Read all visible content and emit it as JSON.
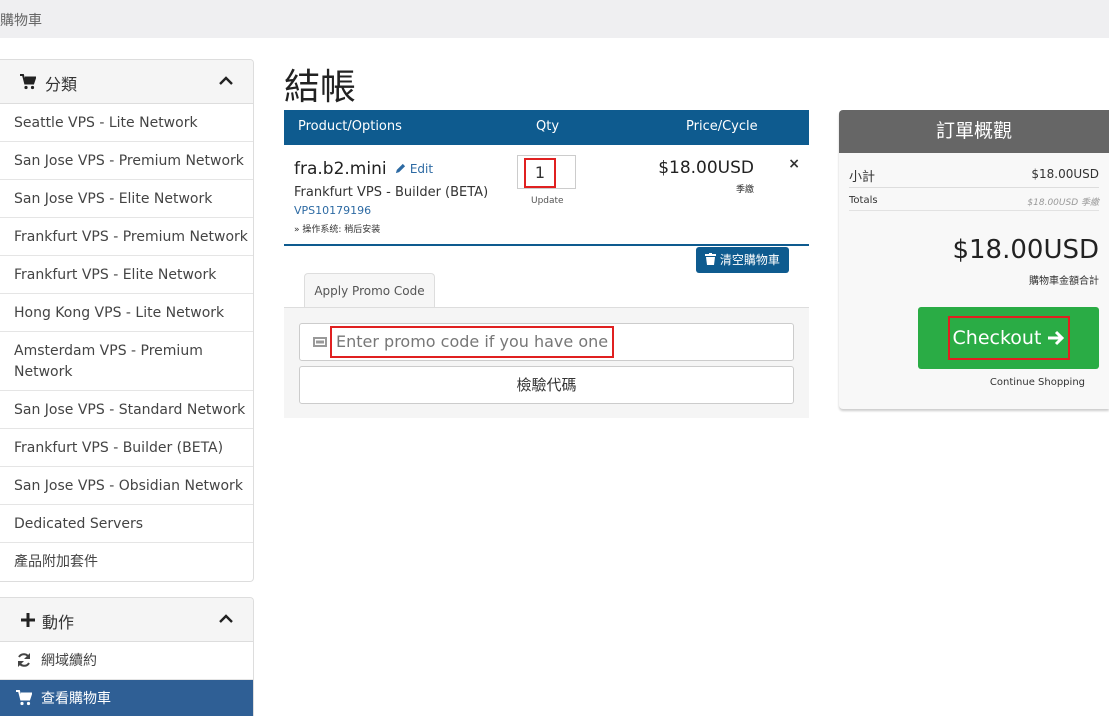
{
  "breadcrumb": "購物車",
  "sidebar": {
    "categories_title": "分類",
    "categories": [
      "Seattle VPS - Lite Network",
      "San Jose VPS - Premium Network",
      "San Jose VPS - Elite Network",
      "Frankfurt VPS - Premium Network",
      "Frankfurt VPS - Elite Network",
      "Hong Kong VPS - Lite Network",
      "Amsterdam VPS - Premium Network",
      "San Jose VPS - Standard Network",
      "Frankfurt VPS - Builder (BETA)",
      "San Jose VPS - Obsidian Network",
      "Dedicated Servers",
      "產品附加套件"
    ],
    "actions_title": "動作",
    "actions": [
      {
        "label": "網域續約",
        "icon": "refresh-icon",
        "active": false
      },
      {
        "label": "查看購物車",
        "icon": "cart-icon",
        "active": true
      }
    ]
  },
  "page_title": "結帳",
  "cart": {
    "headers": {
      "product": "Product/Options",
      "qty": "Qty",
      "price": "Price/Cycle"
    },
    "item": {
      "name": "fra.b2.mini",
      "edit_label": "Edit",
      "group": "Frankfurt VPS - Builder (BETA)",
      "id": "VPS10179196",
      "os": "» 操作系统: 稍后安装",
      "qty": "1",
      "update_label": "Update",
      "price": "$18.00USD",
      "cycle": "季繳",
      "remove": "×"
    },
    "empty_label": "清空購物車"
  },
  "promo": {
    "tab_label": "Apply Promo Code",
    "placeholder": "Enter promo code if you have one",
    "validate_label": "檢驗代碼"
  },
  "summary": {
    "title": "訂單概觀",
    "subtotal_label": "小計",
    "subtotal_value": "$18.00USD",
    "totals_label": "Totals",
    "totals_value": "$18.00USD 季繳",
    "total_due": "$18.00USD",
    "total_due_label": "購物車金額合計",
    "checkout_label": "Checkout",
    "continue_label": "Continue Shopping"
  },
  "colors": {
    "table_header": "#0e5b8f",
    "active_item": "#2f5f95",
    "checkout": "#2aac45",
    "highlight_box": "#e02020"
  }
}
